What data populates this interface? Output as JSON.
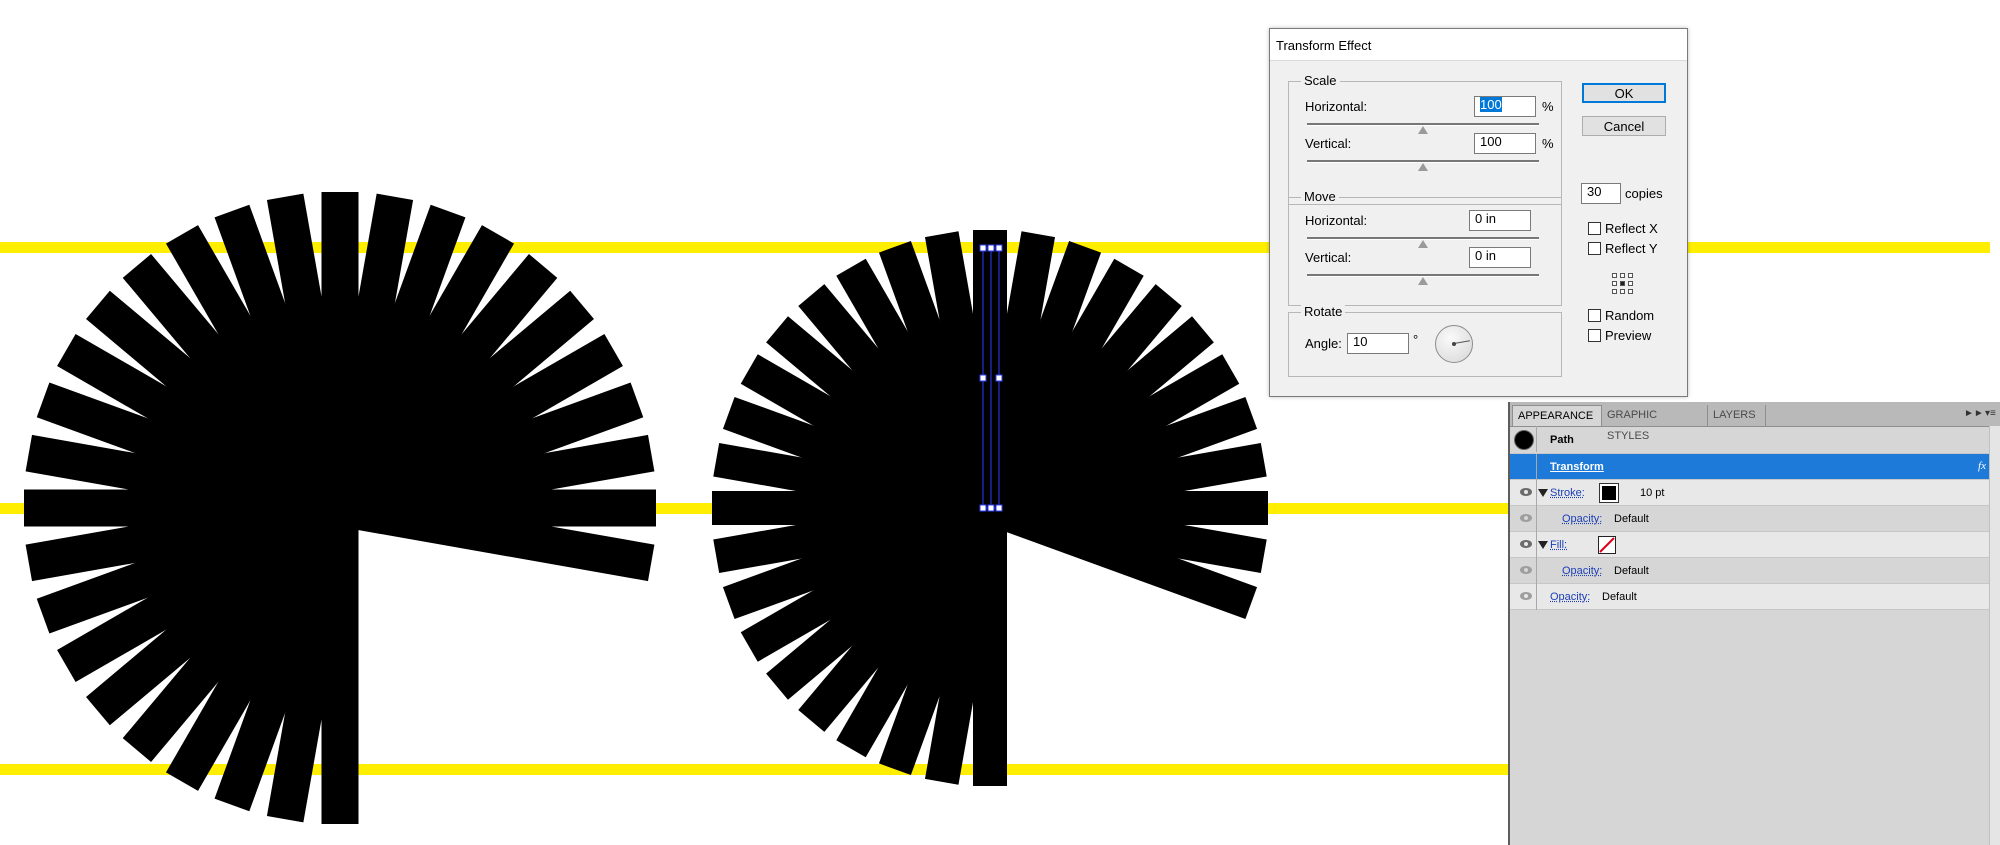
{
  "canvas": {
    "guide_color": "#ffee00",
    "shape_color": "#000000",
    "selection_color": "#2b3cff",
    "left_burst": {
      "rays_drawn": 29,
      "rotation_step_deg": 10,
      "ray_count_with_gap": 36
    },
    "right_burst": {
      "rays_drawn": 30,
      "rotation_step_deg": 10
    }
  },
  "dialog": {
    "title": "Transform Effect",
    "scale": {
      "label": "Scale",
      "horizontal_label": "Horizontal:",
      "horizontal_value": "100",
      "horizontal_unit": "%",
      "vertical_label": "Vertical:",
      "vertical_value": "100",
      "vertical_unit": "%"
    },
    "move": {
      "label": "Move",
      "horizontal_label": "Horizontal:",
      "horizontal_value": "0 in",
      "vertical_label": "Vertical:",
      "vertical_value": "0 in"
    },
    "rotate": {
      "label": "Rotate",
      "angle_label": "Angle:",
      "angle_value": "10",
      "angle_unit": "°"
    },
    "ok_label": "OK",
    "cancel_label": "Cancel",
    "copies_value": "30",
    "copies_label": "copies",
    "reflect_x_label": "Reflect X",
    "reflect_y_label": "Reflect Y",
    "random_label": "Random",
    "preview_label": "Preview",
    "reflect_x_checked": false,
    "reflect_y_checked": false,
    "random_checked": false,
    "preview_checked": false
  },
  "panel": {
    "tabs": [
      "APPEARANCE",
      "GRAPHIC STYLES",
      "LAYERS"
    ],
    "active_tab": "APPEARANCE",
    "header_label": "Path",
    "effect_label": "Transform",
    "fx_label": "fx",
    "stroke_label": "Stroke:",
    "stroke_color": "#000000",
    "stroke_weight": "10 pt",
    "stroke_opacity_label": "Opacity:",
    "stroke_opacity_value": "Default",
    "fill_label": "Fill:",
    "fill_swatch": "none-icon",
    "fill_opacity_label": "Opacity:",
    "fill_opacity_value": "Default",
    "object_opacity_label": "Opacity:",
    "object_opacity_value": "Default",
    "selected_row_color": "#1d7ad9"
  }
}
